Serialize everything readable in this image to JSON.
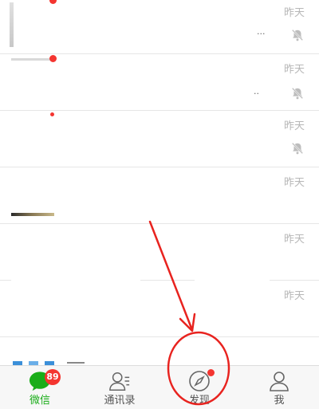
{
  "chats": [
    {
      "time": "昨天",
      "muted": true,
      "ellipsis": "..."
    },
    {
      "time": "昨天",
      "muted": true,
      "ellipsis": ".."
    },
    {
      "time": "昨天",
      "muted": true
    },
    {
      "time": "昨天",
      "muted": false
    },
    {
      "time": "昨天",
      "muted": false
    },
    {
      "time": "昨天",
      "muted": false
    }
  ],
  "tabs": [
    {
      "label": "微信",
      "badge": "89",
      "icon": "chat-bubble-icon"
    },
    {
      "label": "通讯录",
      "icon": "contacts-icon"
    },
    {
      "label": "发现",
      "icon": "compass-icon"
    },
    {
      "label": "我",
      "icon": "person-icon"
    }
  ],
  "colors": {
    "accent": "#1aad19",
    "badge": "#f43530",
    "annotation": "#e8231f"
  }
}
